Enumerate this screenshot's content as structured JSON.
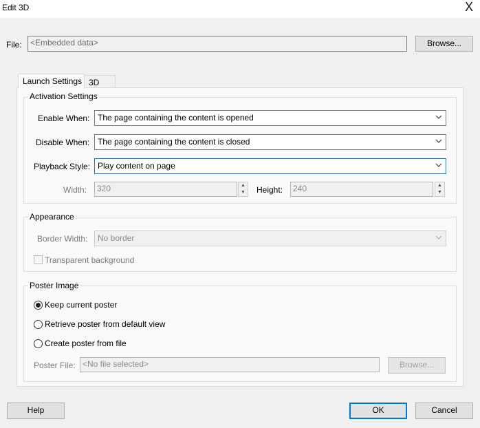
{
  "window": {
    "title": "Edit 3D",
    "close_glyph": "X"
  },
  "file": {
    "label": "File:",
    "value": "<Embedded data>",
    "browse_label": "Browse..."
  },
  "tabs": [
    {
      "label": "Launch Settings",
      "active": true
    },
    {
      "label": "3D",
      "active": false
    }
  ],
  "activation": {
    "title": "Activation Settings",
    "enable_when": {
      "label": "Enable When:",
      "value": "The page containing the content is opened"
    },
    "disable_when": {
      "label": "Disable When:",
      "value": "The page containing the content is closed"
    },
    "playback_style": {
      "label": "Playback Style:",
      "value": "Play content on page"
    },
    "width": {
      "label": "Width:",
      "value": "320"
    },
    "height": {
      "label": "Height:",
      "value": "240"
    }
  },
  "appearance": {
    "title": "Appearance",
    "border_width": {
      "label": "Border Width:",
      "value": "No border"
    },
    "transparent_background": {
      "label": "Transparent background",
      "checked": false
    }
  },
  "poster": {
    "title": "Poster Image",
    "options": [
      {
        "label": "Keep current poster",
        "selected": true
      },
      {
        "label": "Retrieve poster from default view",
        "selected": false
      },
      {
        "label": "Create poster from file",
        "selected": false
      }
    ],
    "poster_file": {
      "label": "Poster File:",
      "value": "<No file selected>",
      "browse_label": "Browse..."
    }
  },
  "footer": {
    "help_label": "Help",
    "ok_label": "OK",
    "cancel_label": "Cancel"
  },
  "colors": {
    "accent": "#0078d7",
    "focus_border": "#2f6cb5"
  }
}
